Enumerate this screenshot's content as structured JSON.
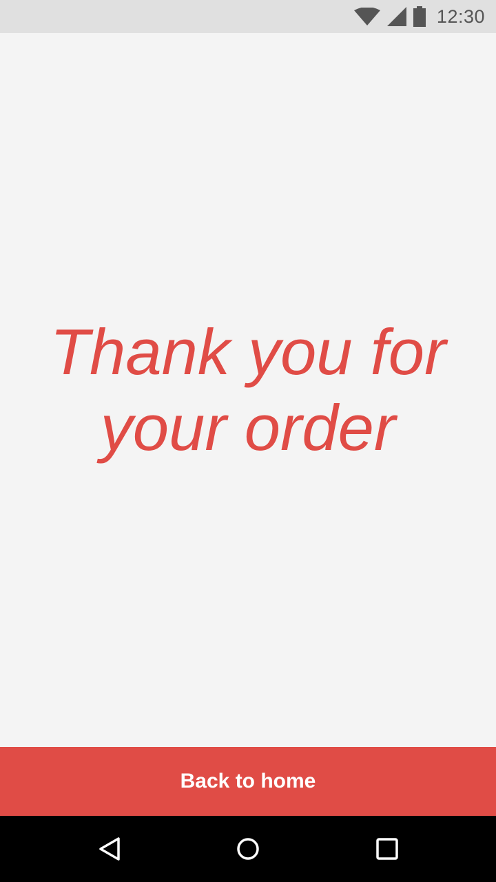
{
  "status_bar": {
    "time": "12:30",
    "icons": [
      "wifi-icon",
      "cell-signal-icon",
      "battery-icon"
    ]
  },
  "main": {
    "message": "Thank you for your order"
  },
  "footer": {
    "back_label": "Back to home"
  },
  "nav_bar": {
    "buttons": [
      "back-nav-icon",
      "home-nav-icon",
      "recents-nav-icon"
    ]
  },
  "colors": {
    "accent": "#e04c46",
    "background": "#f4f4f4",
    "status_bar": "#e0e0e0",
    "nav_bar": "#000000"
  }
}
